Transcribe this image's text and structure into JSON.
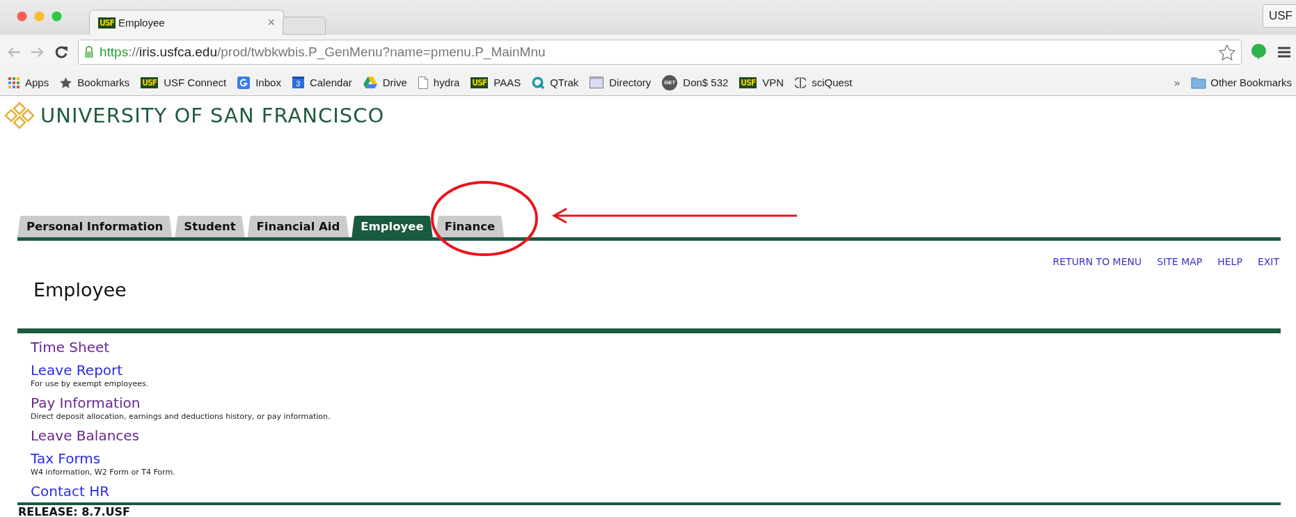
{
  "browser": {
    "tab": {
      "favicon": "USF",
      "title": "Employee",
      "close": "×"
    },
    "profile": "USF",
    "address": [
      {
        "text": "https",
        "kind": "scheme"
      },
      {
        "text": "://",
        "kind": "plain"
      },
      {
        "text": "iris.usfca.edu",
        "kind": "host"
      },
      {
        "text": "/prod/twbkwbis.P_GenMenu?name=pmenu.P_MainMnu",
        "kind": "plain"
      }
    ],
    "bookmarks": [
      {
        "label": "Apps"
      },
      {
        "label": "Bookmarks"
      },
      {
        "label": "USF Connect",
        "badge": "USF"
      },
      {
        "label": "Inbox"
      },
      {
        "label": "Calendar",
        "badge": "3"
      },
      {
        "label": "Drive"
      },
      {
        "label": "hydra"
      },
      {
        "label": "PAAS",
        "badge": "USF"
      },
      {
        "label": "QTrak"
      },
      {
        "label": "Directory"
      },
      {
        "label": "Don$ 532",
        "badge": "GET"
      },
      {
        "label": "VPN",
        "badge": "USF"
      },
      {
        "label": "sciQuest"
      }
    ],
    "overflow": "»",
    "other_bookmarks": "Other Bookmarks"
  },
  "site": {
    "logo_text": "UNIVERSITY OF SAN FRANCISCO"
  },
  "tabs": [
    {
      "label": "Personal Information",
      "selected": false
    },
    {
      "label": "Student",
      "selected": false
    },
    {
      "label": "Financial Aid",
      "selected": false
    },
    {
      "label": "Employee",
      "selected": true
    },
    {
      "label": "Finance",
      "selected": false
    }
  ],
  "top_links": [
    "RETURN TO MENU",
    "SITE MAP",
    "HELP",
    "EXIT"
  ],
  "heading": "Employee",
  "menu": [
    {
      "title": "Time Sheet",
      "visited": true
    },
    {
      "title": "Leave Report",
      "visited": false,
      "description": "For use by exempt employees."
    },
    {
      "title": "Pay Information",
      "visited": true,
      "description": "Direct deposit allocation, earnings and deductions history, or pay information."
    },
    {
      "title": "Leave Balances",
      "visited": true
    },
    {
      "title": "Tax Forms",
      "visited": false,
      "description": "W4 information, W2 Form or T4 Form."
    },
    {
      "title": "Contact HR",
      "visited": false
    }
  ],
  "release": "RELEASE: 8.7.USF"
}
